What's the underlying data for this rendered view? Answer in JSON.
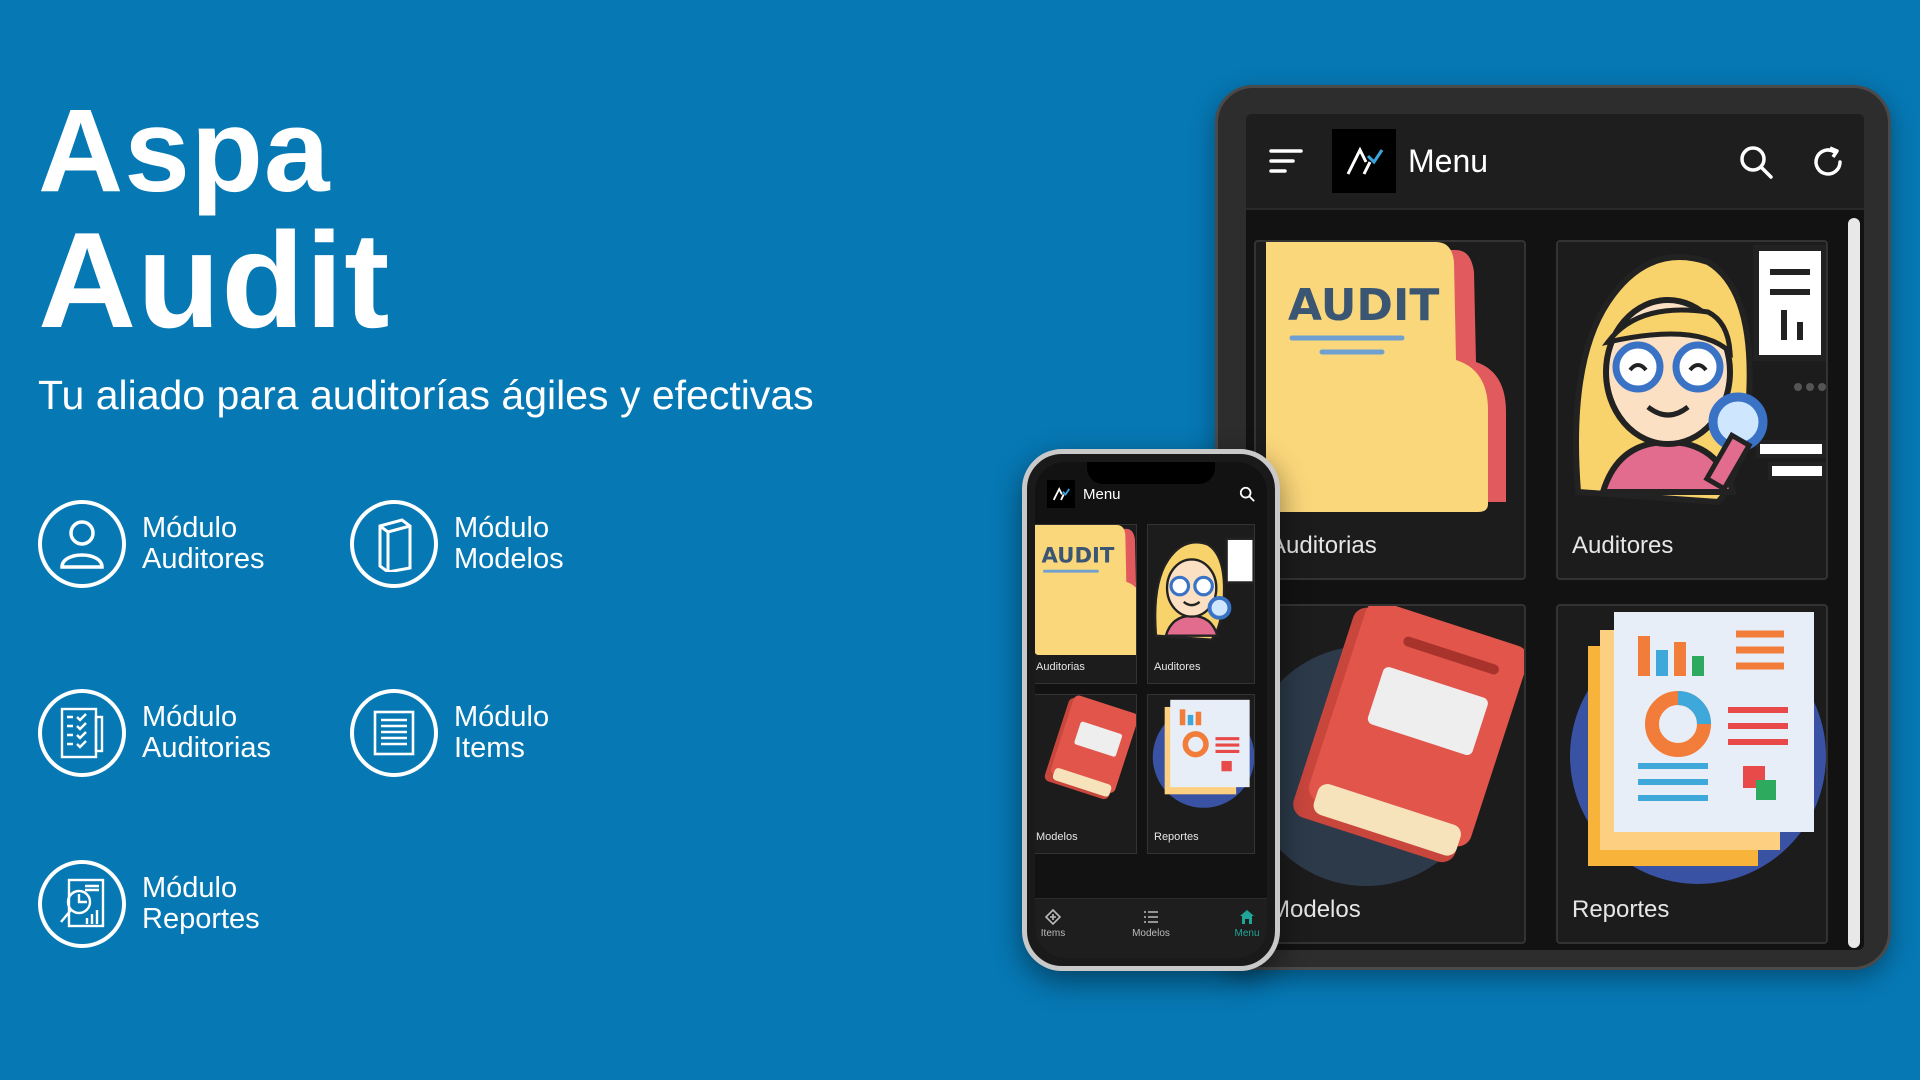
{
  "hero": {
    "title_line1": "Aspa",
    "title_line2": "Audit",
    "tagline": "Tu aliado para auditorías ágiles y efectivas"
  },
  "modules": [
    {
      "line1": "Módulo",
      "line2": "Auditores",
      "icon": "user-icon"
    },
    {
      "line1": "Módulo",
      "line2": "Modelos",
      "icon": "book-icon"
    },
    {
      "line1": "Módulo",
      "line2": "Auditorias",
      "icon": "checklist-icon"
    },
    {
      "line1": "Módulo",
      "line2": "Items",
      "icon": "list-document-icon"
    },
    {
      "line1": "Módulo",
      "line2": "Reportes",
      "icon": "report-analysis-icon"
    }
  ],
  "tablet": {
    "header_title": "Menu",
    "cards": [
      "Auditorias",
      "Auditores",
      "Modelos",
      "Reportes"
    ],
    "audit_graphic_text": "AUDIT"
  },
  "phone": {
    "header_title": "Menu",
    "cards": [
      "Auditorias",
      "Auditores",
      "Modelos",
      "Reportes"
    ],
    "audit_graphic_text": "AUDIT",
    "tabs": [
      "Items",
      "Modelos",
      "Menu"
    ],
    "active_tab": "Menu"
  },
  "colors": {
    "background": "#0678b4",
    "app_surface": "#121212",
    "active_tab": "#21a598"
  }
}
